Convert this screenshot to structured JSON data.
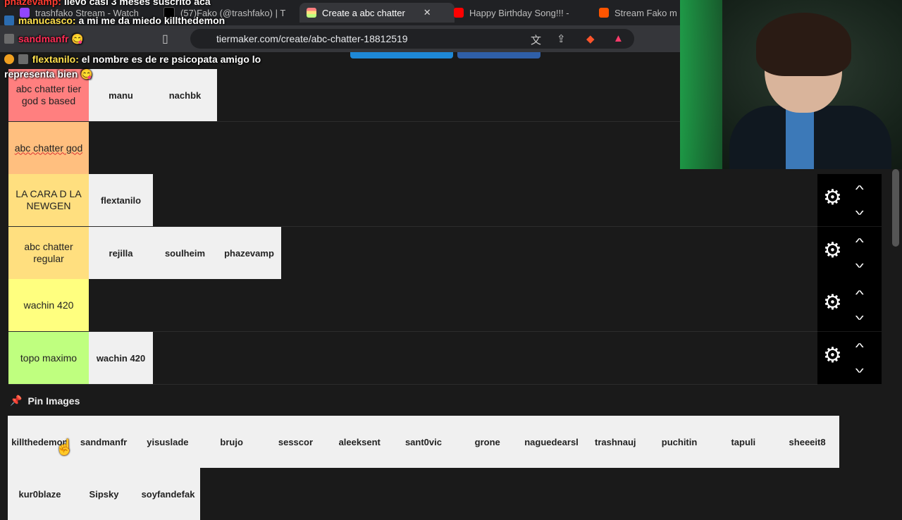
{
  "browser": {
    "tabs": [
      {
        "label": "trashfako Stream - Watch",
        "color": "#9146ff"
      },
      {
        "label": "(57)Fako (@trashfako) | T",
        "color": "#000000"
      },
      {
        "label": "Create a abc chatter",
        "color": "#e84a7f",
        "active": true
      },
      {
        "label": "Happy Birthday Song!!! -",
        "color": "#ff0000"
      },
      {
        "label": "Stream Fako m",
        "color": "#ff5500"
      }
    ],
    "close_glyph": "✕",
    "url": "tiermaker.com/create/abc-chatter-18812519"
  },
  "tiers": [
    {
      "label": "abc chatter tier god s based",
      "color": "#ff7f7f",
      "items": [
        "manu",
        "nachbk"
      ]
    },
    {
      "label": "abc chatter god",
      "color": "#ffbf7f",
      "items": []
    },
    {
      "label": "LA CARA D LA NEWGEN",
      "color": "#ffdf7f",
      "items": [
        "flextanilo"
      ]
    },
    {
      "label": "abc chatter regular",
      "color": "#ffdf7f",
      "items": [
        "rejilla",
        "soulheim",
        "phazevamp"
      ]
    },
    {
      "label": "wachin 420",
      "color": "#ffff7f",
      "items": []
    },
    {
      "label": "topo maximo",
      "color": "#bfff7f",
      "items": [
        "wachin 420"
      ]
    }
  ],
  "pin_label": "Pin Images",
  "pool_row1": [
    "killthedemon",
    "sandmanfr",
    "yisuslade",
    "brujo",
    "sesscor",
    "aleeksent",
    "sant0vic",
    "grone",
    "naguedearsl",
    "trashnauj",
    "puchitin",
    "tapuli",
    "sheeeit8"
  ],
  "pool_row2": [
    "kur0blaze",
    "Sipsky",
    "soyfandefak"
  ],
  "chat": [
    {
      "user": "phazevamp:",
      "user_color": "#ff3b30",
      "text": "llevo casi 3 meses suscrito aca"
    },
    {
      "user": "manucasco:",
      "user_color": "#ffe14d",
      "text": "a mi me da miedo killthedemon"
    },
    {
      "user": "sandmanfr",
      "user_color": "#ff2d55",
      "text": ""
    },
    {
      "user": "flextanilo:",
      "user_color": "#ffe14d",
      "text": "el nombre es de re psicopata amigo lo"
    },
    {
      "user": "",
      "user_color": "#ffffff",
      "text": "representa bien"
    }
  ]
}
